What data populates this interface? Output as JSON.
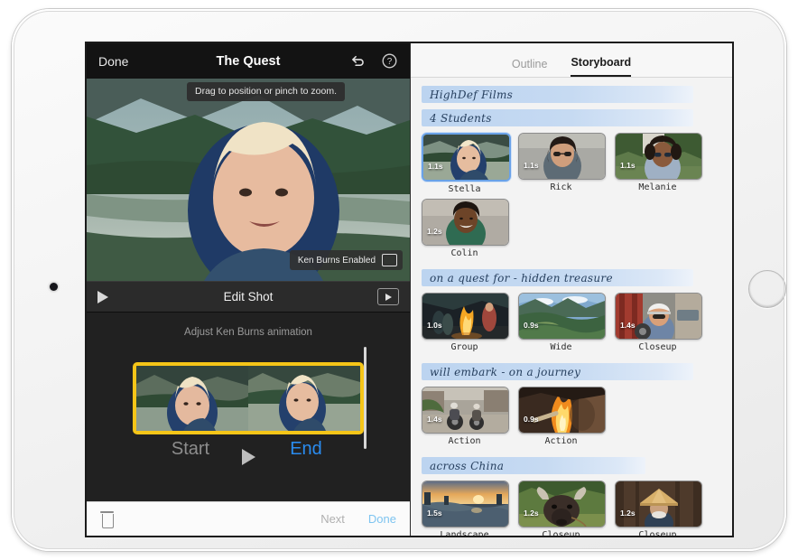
{
  "device": {
    "camera": "front-camera",
    "home": "home-button"
  },
  "editor": {
    "nav": {
      "done": "Done",
      "title": "The Quest",
      "undo_icon": "undo-icon",
      "help_icon": "help-icon"
    },
    "tooltip": "Drag to position or pinch to zoom.",
    "ken_burns_badge": "Ken Burns Enabled",
    "edit_bar": {
      "title": "Edit Shot",
      "play_icon": "play-icon",
      "preview_icon": "play-in-box-icon"
    },
    "hint": "Adjust Ken Burns animation",
    "start_label": "Start",
    "end_label": "End",
    "big_play_icon": "play-icon",
    "bottom": {
      "trash_icon": "trash-icon",
      "next": "Next",
      "done": "Done"
    }
  },
  "panel": {
    "tabs": [
      {
        "label": "Outline",
        "active": false
      },
      {
        "label": "Storyboard",
        "active": true
      }
    ],
    "sections": [
      {
        "band": "HighDef Films",
        "band_width": "mid",
        "shots": []
      },
      {
        "band": "4 Students",
        "band_width": "mid",
        "shots": [
          {
            "caption": "Stella",
            "duration": "1.1s",
            "selected": true,
            "scene": "stella"
          },
          {
            "caption": "Rick",
            "duration": "1.1s",
            "selected": false,
            "scene": "rick"
          },
          {
            "caption": "Melanie",
            "duration": "1.1s",
            "selected": false,
            "scene": "melanie"
          },
          {
            "caption": "Colin",
            "duration": "1.2s",
            "selected": false,
            "scene": "colin"
          }
        ]
      },
      {
        "band": "on a quest for - hidden treasure",
        "band_width": "mid",
        "shots": [
          {
            "caption": "Group",
            "duration": "1.0s",
            "selected": false,
            "scene": "group"
          },
          {
            "caption": "Wide",
            "duration": "0.9s",
            "selected": false,
            "scene": "wide"
          },
          {
            "caption": "Closeup",
            "duration": "1.4s",
            "selected": false,
            "scene": "closeup1"
          }
        ]
      },
      {
        "band": "will embark - on a journey",
        "band_width": "mid",
        "shots": [
          {
            "caption": "Action",
            "duration": "1.4s",
            "selected": false,
            "scene": "action1"
          },
          {
            "caption": "Action",
            "duration": "0.9s",
            "selected": false,
            "scene": "action2"
          }
        ]
      },
      {
        "band": "across China",
        "band_width": "short",
        "shots": [
          {
            "caption": "Landscape",
            "duration": "1.5s",
            "selected": false,
            "scene": "landscape"
          },
          {
            "caption": "Closeup",
            "duration": "1.2s",
            "selected": false,
            "scene": "buffalo"
          },
          {
            "caption": "Closeup",
            "duration": "1.2s",
            "selected": false,
            "scene": "hat"
          }
        ]
      }
    ]
  },
  "colors": {
    "accent_blue": "#2a8cf0",
    "selection_yellow": "#f5c518",
    "band_blue": "#bcd4f0",
    "dark_chrome": "#1c1c1c"
  }
}
